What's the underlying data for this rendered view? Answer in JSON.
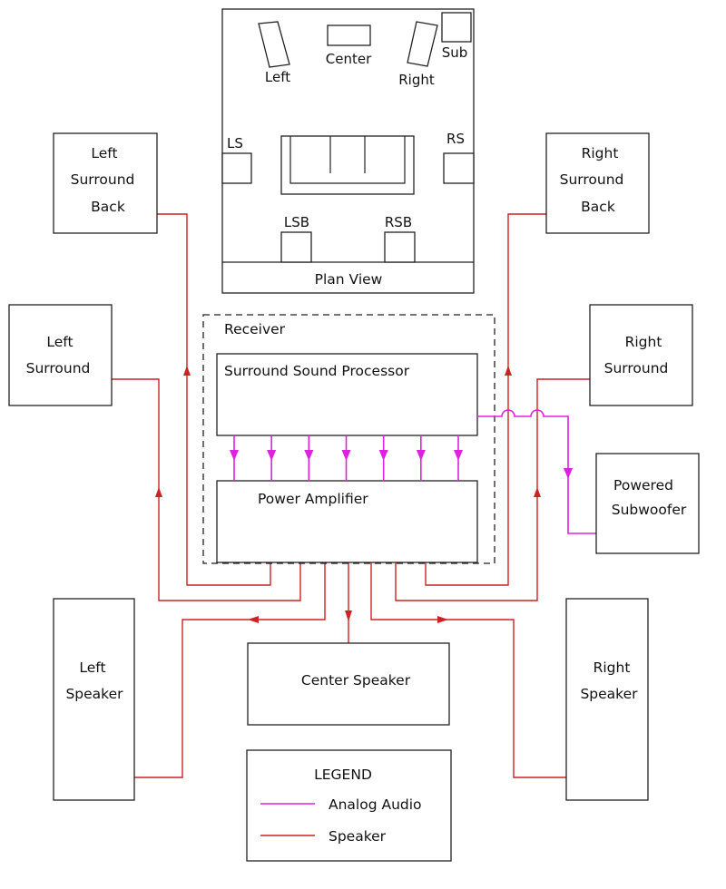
{
  "colors": {
    "speaker_wire": "#cc2222",
    "analog_audio": "#e020e0",
    "outline": "#222222"
  },
  "plan_view": {
    "title": "Plan View",
    "labels": {
      "left": "Left",
      "center": "Center",
      "right": "Right",
      "sub": "Sub",
      "ls": "LS",
      "rs": "RS",
      "lsb": "LSB",
      "rsb": "RSB"
    }
  },
  "receiver": {
    "label": "Receiver",
    "processor": "Surround Sound Processor",
    "amplifier": "Power Amplifier",
    "analog_channel_count": 7
  },
  "speakers": {
    "left_surround_back": [
      "Left",
      "Surround",
      "Back"
    ],
    "right_surround_back": [
      "Right",
      "Surround",
      "Back"
    ],
    "left_surround": [
      "Left",
      "Surround"
    ],
    "right_surround": [
      "Right",
      "Surround"
    ],
    "powered_subwoofer": [
      "Powered",
      "Subwoofer"
    ],
    "left_speaker": [
      "Left",
      "Speaker"
    ],
    "center_speaker": "Center Speaker",
    "right_speaker": [
      "Right",
      "Speaker"
    ]
  },
  "legend": {
    "title": "LEGEND",
    "items": [
      {
        "label": "Analog Audio",
        "type": "analog"
      },
      {
        "label": "Speaker",
        "type": "speaker"
      }
    ]
  }
}
